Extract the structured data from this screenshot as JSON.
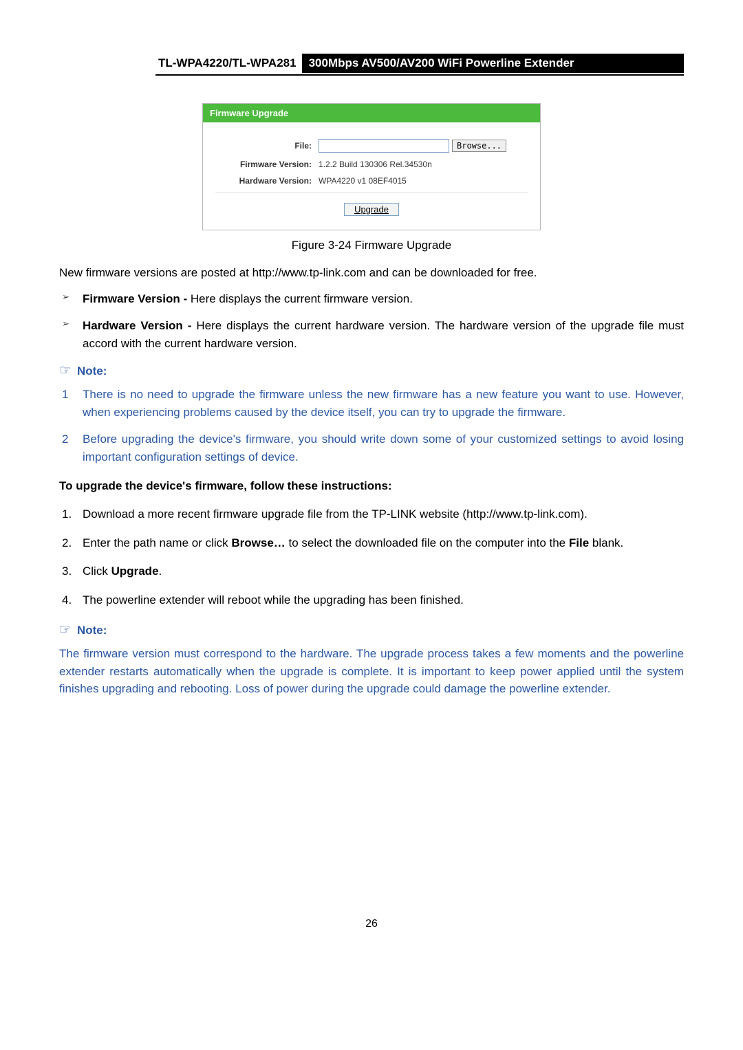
{
  "header": {
    "model": "TL-WPA4220/TL-WPA281",
    "product": "300Mbps AV500/AV200 WiFi Powerline Extender"
  },
  "figure": {
    "panel_title": "Firmware Upgrade",
    "file_label": "File:",
    "file_value": "",
    "browse_btn": "Browse...",
    "fw_label": "Firmware Version:",
    "fw_value": "1.2.2 Build 130306 Rel.34530n",
    "hw_label": "Hardware Version:",
    "hw_value": "WPA4220 v1 08EF4015",
    "upgrade_btn": "Upgrade",
    "caption": "Figure 3-24 Firmware Upgrade"
  },
  "intro_text": "New firmware versions are posted at http://www.tp-link.com and can be downloaded for free.",
  "bullets": {
    "b1_bold": "Firmware Version - ",
    "b1_rest": "Here displays the current firmware version.",
    "b2_bold": "Hardware Version - ",
    "b2_rest": "Here displays the current hardware version. The hardware version of the upgrade file must accord with the current hardware version."
  },
  "note1": {
    "label": "Note:",
    "item1": "There is no need to upgrade the firmware unless the new firmware has a new feature you want to use. However, when experiencing problems caused by the device itself, you can try to upgrade the firmware.",
    "item2": "Before upgrading the device's firmware, you should write down some of your customized settings to avoid losing important configuration settings of device."
  },
  "instructions": {
    "heading": "To upgrade the device's firmware, follow these instructions:",
    "s1": "Download a more recent firmware upgrade file from the TP-LINK website (http://www.tp-link.com).",
    "s2_a": "Enter the path name or click ",
    "s2_b_bold": "Browse…",
    "s2_c": " to select the downloaded file on the computer into the ",
    "s2_d_bold": "File",
    "s2_e": " blank.",
    "s3_a": "Click ",
    "s3_b_bold": "Upgrade",
    "s3_c": ".",
    "s4": "The powerline extender will reboot while the upgrading has been finished."
  },
  "note2": {
    "label": "Note:",
    "text": "The firmware version must correspond to the hardware. The upgrade process takes a few moments and the powerline extender restarts automatically when the upgrade is complete. It is important to keep power applied until the system finishes upgrading and rebooting. Loss of power during the upgrade could damage the powerline extender."
  },
  "page_number": "26"
}
